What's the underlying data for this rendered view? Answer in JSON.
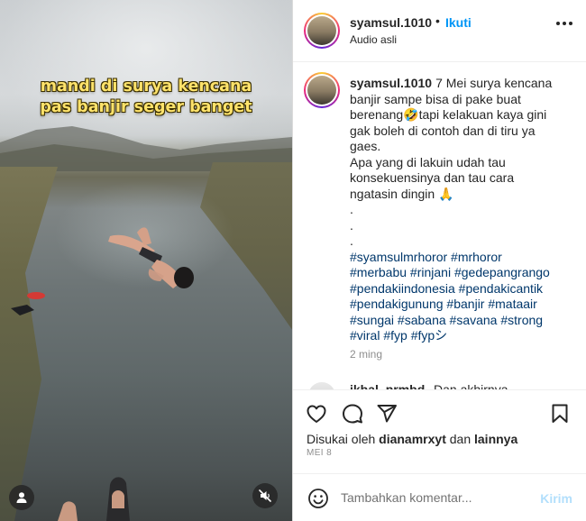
{
  "video": {
    "overlay_lines": [
      "mandi di surya kencana",
      "pas banjir seger banget"
    ],
    "tag_button_icon": "user-tag-icon",
    "mute_button_icon": "muted-speaker-icon"
  },
  "header": {
    "username": "syamsul.1010",
    "separator": "•",
    "follow_label": "Ikuti",
    "audio_label": "Audio asli",
    "more_icon": "more-options-icon"
  },
  "caption": {
    "username": "syamsul.1010",
    "lines": [
      "7 Mei surya kencana",
      "banjir sampe bisa di pake buat",
      "berenang🤣tapi kelakuan kaya gini",
      "gak boleh di contoh dan di tiru ya",
      "gaes.",
      "Apa yang di lakuin udah tau",
      "konsekuensinya dan tau cara",
      "ngatasin dingin 🙏",
      ".",
      ".",
      "."
    ],
    "hashtags": [
      "#syamsulmrhoror #mrhoror",
      "#merbabu #rinjani #gedepangrango",
      "#pendakiindonesia #pendakicantik",
      "#pendakigunung #banjir #mataair",
      "#sungai #sabana #savana #strong",
      "#viral #fyp #fypシ"
    ],
    "time_ago": "2 ming"
  },
  "comments": [
    {
      "username": "ikbal_prmbd",
      "text": "Dan akhirnya"
    }
  ],
  "actions": {
    "like_icon": "heart-icon",
    "comment_icon": "comment-bubble-icon",
    "share_icon": "paper-plane-icon",
    "save_icon": "bookmark-icon",
    "liked_by_prefix": "Disukai oleh",
    "liked_by_user": "dianamrxyt",
    "liked_by_joiner": "dan",
    "liked_by_suffix": "lainnya",
    "date": "MEI 8"
  },
  "comment_bar": {
    "emoji_icon": "emoji-smile-icon",
    "placeholder": "Tambahkan komentar...",
    "send_label": "Kirim"
  },
  "colors": {
    "accent": "#0095f6",
    "send_disabled": "#b2dffc",
    "hashtag": "#00376b",
    "overlay_text": "#ffe36b"
  }
}
